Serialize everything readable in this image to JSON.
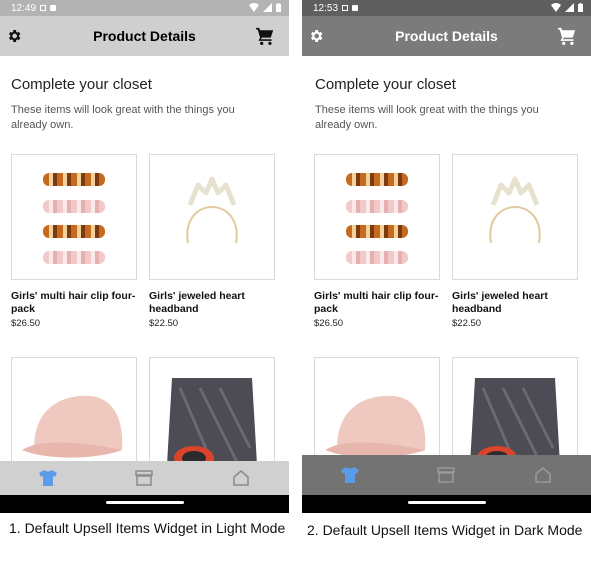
{
  "screens": [
    {
      "status_time": "12:49",
      "app_title": "Product Details",
      "heading": "Complete your closet",
      "subtext": "These items will look great with the things you already own.",
      "products": [
        {
          "name": "Girls' multi hair clip four-pack",
          "price": "$26.50",
          "image_icon": "hair-clips-image"
        },
        {
          "name": "Girls' jeweled heart headband",
          "price": "$22.50",
          "image_icon": "headband-image"
        },
        {
          "name": "",
          "price": "",
          "image_icon": "pink-cap-image"
        },
        {
          "name": "",
          "price": "",
          "image_icon": "drawstring-bag-image"
        }
      ],
      "caption": "1. Default Upsell Items Widget in Light Mode"
    },
    {
      "status_time": "12:53",
      "app_title": "Product Details",
      "heading": "Complete your closet",
      "subtext": "These items will look great with the things you already own.",
      "products": [
        {
          "name": "Girls' multi hair clip four-pack",
          "price": "$26.50",
          "image_icon": "hair-clips-image"
        },
        {
          "name": "Girls' jeweled heart headband",
          "price": "$22.50",
          "image_icon": "headband-image"
        },
        {
          "name": "",
          "price": "",
          "image_icon": "pink-cap-image"
        },
        {
          "name": "",
          "price": "",
          "image_icon": "drawstring-bag-image"
        }
      ],
      "caption": "2. Default Upsell Items Widget in Dark Mode"
    }
  ],
  "nav_icons": [
    "shirt-icon",
    "store-icon",
    "home-icon"
  ],
  "colors": {
    "light_appbar": "#cfcfcf",
    "dark_appbar": "#7b7b7b",
    "active_nav": "#5b9be8",
    "inactive_nav": "#8a8a8a"
  }
}
